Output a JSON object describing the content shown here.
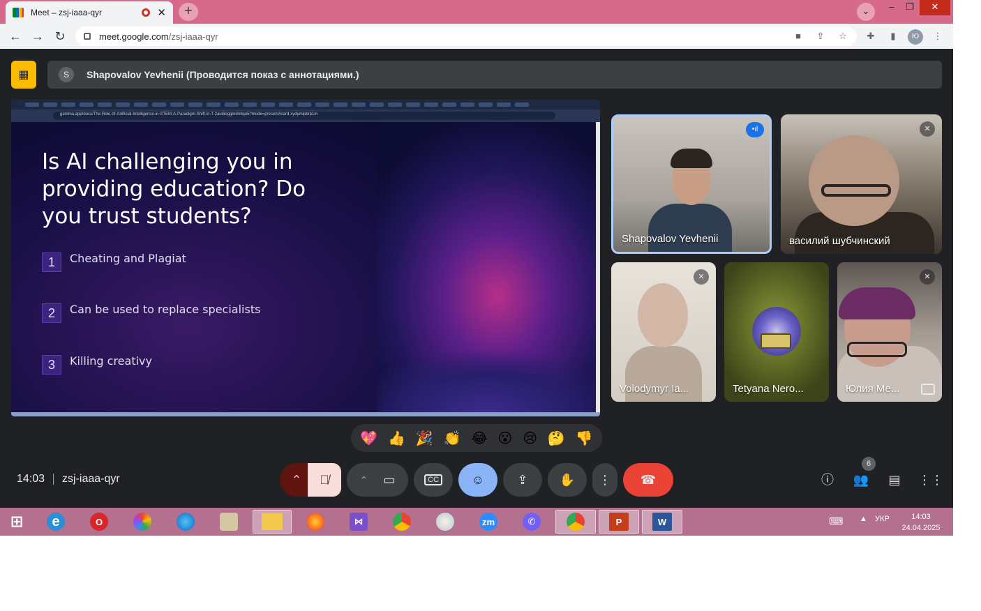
{
  "browser": {
    "tab_title": "Meet – zsj-iaaa-qyr",
    "tab_close": "✕",
    "new_tab": "+",
    "url_host": "meet.google.com",
    "url_path": "/zsj-iaaa-qyr",
    "profile_initial": "Ю",
    "window_controls": [
      "–",
      "❐",
      "✕"
    ]
  },
  "meet": {
    "banner_initial": "S",
    "banner_text": "Shapovalov Yevhenii (Проводится показ с аннотациями.)",
    "presentation": {
      "inner_url": "gamma.app/docs/The-Role-of-Artificial-Intelligence-in-STEM-A-Paradigm-Shift-in-T-2aui8oggmdmtqu5?mode=present#card-xydymipbrp1m",
      "title": "Is AI challenging you in providing education? Do you trust students?",
      "items": [
        {
          "num": "1",
          "text": "Cheating and Plagiat"
        },
        {
          "num": "2",
          "text": "Can be used to replace specialists"
        },
        {
          "num": "3",
          "text": "Killing creativy"
        }
      ]
    },
    "participants": [
      {
        "name": "Shapovalov Yevhenii",
        "speaking": true
      },
      {
        "name": "василий шубчинский",
        "muted": true
      },
      {
        "name": "Volodymyr Ia...",
        "muted": true
      },
      {
        "name": "Tetyana Nero..."
      },
      {
        "name": "Юлия Ме...",
        "muted": true
      }
    ],
    "reactions": [
      "💖",
      "👍",
      "🎉",
      "👏",
      "😂",
      "😮",
      "😢",
      "🤔",
      "👎"
    ],
    "time": "14:03",
    "meeting_code": "zsj-iaaa-qyr",
    "participant_count": "6"
  },
  "taskbar": {
    "apps": [
      "windows-start",
      "internet-explorer",
      "opera",
      "picasa",
      "edge",
      "app-scroll",
      "file-explorer",
      "firefox",
      "visual-studio",
      "chrome",
      "paint",
      "zoom",
      "viber",
      "chrome-active",
      "powerpoint",
      "word"
    ],
    "zoom_label": "zm",
    "lang": "УКР",
    "time": "14:03",
    "date": "24.04.2025"
  },
  "colors": {
    "title_bar": "#d7698a",
    "meet_bg": "#202124",
    "accent_yellow": "#fbbc04",
    "end_call_red": "#ea4335",
    "emoji_btn_blue": "#8ab4f8",
    "taskbar": "#b3708f"
  }
}
